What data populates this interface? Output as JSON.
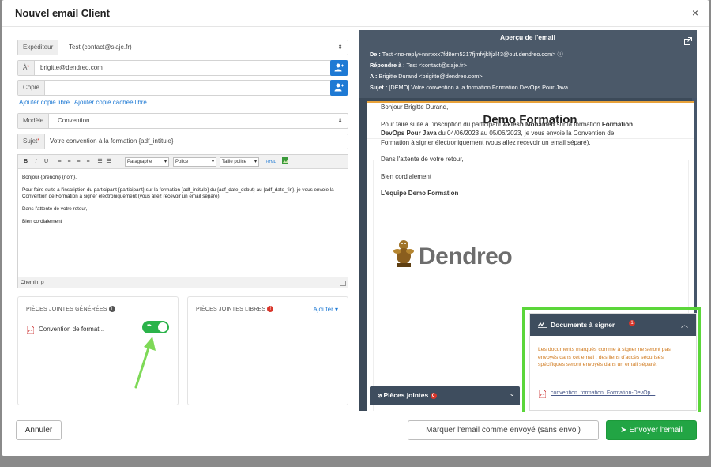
{
  "modal": {
    "title": "Nouvel email Client",
    "close": "×"
  },
  "form": {
    "expediteur": {
      "label": "Expéditeur",
      "value": "Test (contact@siaje.fr)"
    },
    "a": {
      "label": "À",
      "required_mark": "*",
      "value": "brigitte@dendreo.com"
    },
    "copie": {
      "label": "Copie",
      "value": ""
    },
    "links": {
      "copie_libre": "Ajouter copie libre",
      "copie_cachee": "Ajouter copie cachée libre"
    },
    "modele": {
      "label": "Modèle",
      "value": "Convention"
    },
    "sujet": {
      "label": "Sujet",
      "required_mark": "*",
      "value": "Votre convention à la formation {adf_intitule}"
    }
  },
  "editor": {
    "toolbar": {
      "bold": "B",
      "italic": "I",
      "underline": "U",
      "format": "Paragraphe",
      "font": "Police",
      "size": "Taille police",
      "html": "HTML"
    },
    "lines": [
      "Bonjour {prenom} {nom},",
      "Pour faire suite à l'inscription du participant {participant} sur la formation {adf_intitule} du {adf_date_debut} au {adf_date_fin}, je vous envoie la Convention de Formation à signer électroniquement (vous allez recevoir un email séparé).",
      "Dans l'attente de votre retour,",
      "Bien cordialement"
    ],
    "path": "Chemin: p"
  },
  "attachments": {
    "generated": {
      "title": "PIÈCES JOINTES GÉNÉRÉES",
      "info": "i",
      "file": "Convention de format...",
      "toggle_label": "✒"
    },
    "libres": {
      "title": "PIÈCES JOINTES LIBRES",
      "badge": "!",
      "add": "Ajouter"
    }
  },
  "footer": {
    "cancel": "Annuler",
    "mark_sent": "Marquer l'email comme envoyé (sans envoi)",
    "send": "Envoyer l'email"
  },
  "preview": {
    "title": "Aperçu de l'email",
    "de_label": "De :",
    "de_value": "Test <no-reply+nnnxxx7fd8em5217fjmfvjkltjzl43@out.dendreo.com>",
    "repondre_label": "Répondre à :",
    "repondre_value": "Test <contact@siaje.fr>",
    "a_label": "A :",
    "a_value": "Brigitte Durand <brigitte@dendreo.com>",
    "sujet_label": "Sujet :",
    "sujet_value": "[DEMO] Votre convention à la formation Formation DevOps Pour Java",
    "email_title": "Demo Formation",
    "greeting": "Bonjour Brigitte Durand,",
    "para1_a": "Pour faire suite à l'inscription du participant ",
    "para1_participant": "Akiesh Mohamed",
    "para1_b": " sur la formation ",
    "para1_formation": "Formation DevOps Pour Java",
    "para1_c": " du 04/06/2023 au 05/06/2023, je vous envoie la Convention de Formation à signer électroniquement (vous allez recevoir un email séparé).",
    "para2": "Dans l'attente de votre retour,",
    "para3": "Bien cordialement",
    "signature": "L'equipe Demo Formation",
    "logo_text": "Dendreo",
    "pieces_jointes": "Pièces jointes",
    "pieces_badge": "0"
  },
  "sign": {
    "title": "Documents à signer",
    "badge": "1",
    "note": "Les documents marqués comme à signer ne seront pas envoyés dans cet email : des liens d'accès sécurisés spécifiques seront envoyés dans un email séparé.",
    "file": "convention_formation_Formation-DevOp..."
  },
  "colors": {
    "primary": "#1f7ad4",
    "success": "#22a544",
    "highlight": "#5bd63a",
    "dark_panel": "#3e4d5e",
    "warning_text": "#d07a1e"
  }
}
